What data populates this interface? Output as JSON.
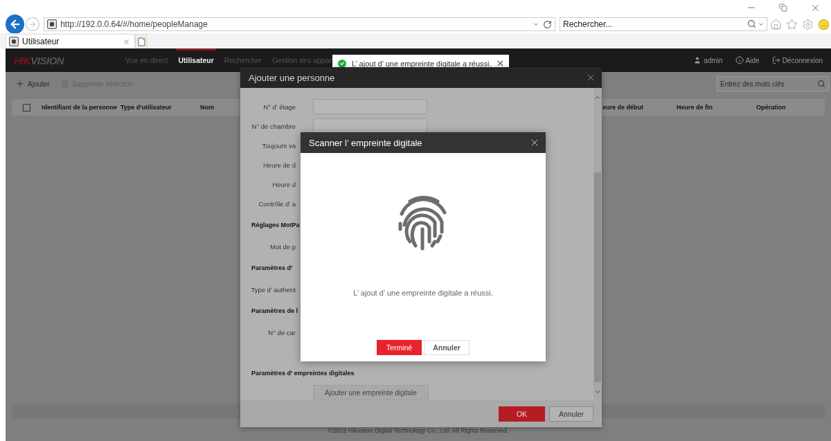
{
  "browser": {
    "url": "http://192.0.0.64/#/home/peopleManage",
    "search_placeholder": "Rechercher...",
    "tabs": [
      {
        "label": "Utilisateur",
        "selected": true
      }
    ]
  },
  "header": {
    "logo": {
      "prefix": "HIK",
      "suffix": "VISION"
    },
    "nav": [
      {
        "label": "Vue en direct",
        "selected": false
      },
      {
        "label": "Utilisateur",
        "selected": true
      },
      {
        "label": "Rechercher",
        "selected": false
      },
      {
        "label": "Gestion des appar",
        "selected": false
      }
    ],
    "user_menu": [
      {
        "kind": "user",
        "label": "admin"
      },
      {
        "kind": "help",
        "label": "Aide"
      },
      {
        "kind": "logout",
        "label": "Déconnexion"
      }
    ]
  },
  "toast": {
    "message": "L’ ajout d’ une empreinte digitale a réussi."
  },
  "toolbar": {
    "actions": [
      {
        "kind": "add",
        "label": "Ajouter",
        "disabled": false
      },
      {
        "kind": "delete",
        "label": "Supprimer sélection",
        "disabled": true
      }
    ],
    "search": {
      "placeholder": "Entrez des mots clés"
    }
  },
  "table": {
    "select_all_checked": false,
    "columns": [
      "Identifiant de la personne",
      "Type d’utilisateur",
      "Nom",
      "eure de début",
      "Heure de fin",
      "Opération"
    ]
  },
  "person_dialog": {
    "title": "Ajouter une personne",
    "rows": [
      {
        "kind": "input",
        "label": "N° d’ étage"
      },
      {
        "kind": "input",
        "label": "N° de chambre"
      },
      {
        "kind": "label",
        "label": "Toujours va"
      },
      {
        "kind": "label",
        "label": "Heure de d"
      },
      {
        "kind": "label",
        "label": "Heure d"
      },
      {
        "kind": "label",
        "label": "Contrôle d’ a"
      },
      {
        "kind": "heading",
        "label": "Réglages MotPa"
      },
      {
        "kind": "label",
        "label": "Mot de p"
      },
      {
        "kind": "heading",
        "label": "Paramètres d’"
      },
      {
        "kind": "label",
        "label": "Type d’ authent"
      },
      {
        "kind": "heading",
        "label": "Paramètres de l"
      },
      {
        "kind": "label",
        "label": "N° de car"
      }
    ],
    "fingerprint_section": {
      "heading": "Paramètres d’ empreintes digitales",
      "button": "Ajouter une empreinte digitale"
    },
    "buttons": [
      {
        "kind": "primary",
        "label": "OK"
      },
      {
        "kind": "secondary",
        "label": "Annuler"
      }
    ]
  },
  "scan_dialog": {
    "title": "Scanner l’ empreinte digitale",
    "message": "L’ ajout d’ une empreinte digitale a réussi.",
    "buttons": [
      {
        "kind": "primary",
        "label": "Terminé"
      },
      {
        "kind": "secondary",
        "label": "Annuler"
      }
    ]
  },
  "copyright": "©2022 Hikvision Digital Technology Co., Ltd. All Rights Reserved."
}
